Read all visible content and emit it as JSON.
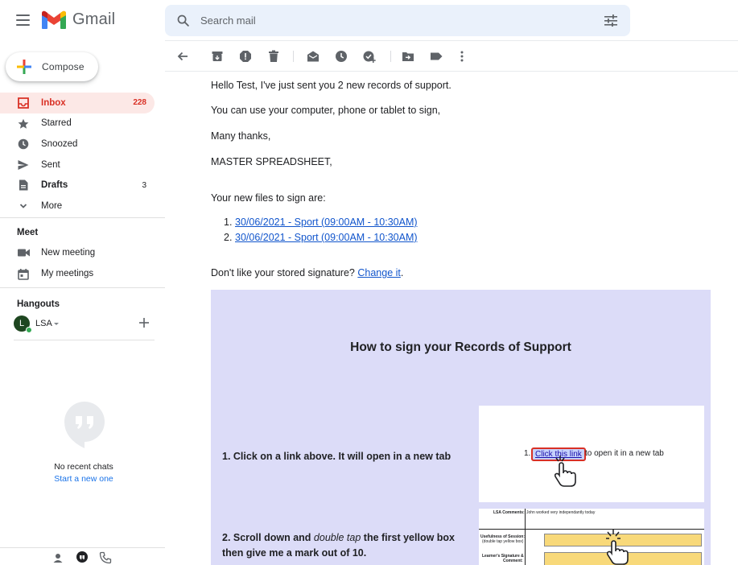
{
  "app": {
    "logo_text": "Gmail"
  },
  "search": {
    "placeholder": "Search mail"
  },
  "compose": {
    "label": "Compose"
  },
  "nav": [
    {
      "name": "inbox",
      "label": "Inbox",
      "count": "228",
      "icon": "inbox-icon",
      "active": true
    },
    {
      "name": "starred",
      "label": "Starred",
      "count": "",
      "icon": "star-icon"
    },
    {
      "name": "snoozed",
      "label": "Snoozed",
      "count": "",
      "icon": "clock-icon"
    },
    {
      "name": "sent",
      "label": "Sent",
      "count": "",
      "icon": "send-icon"
    },
    {
      "name": "drafts",
      "label": "Drafts",
      "count": "3",
      "icon": "draft-icon",
      "bold": true
    },
    {
      "name": "more",
      "label": "More",
      "count": "",
      "icon": "chevron-down-icon"
    }
  ],
  "meet": {
    "title": "Meet",
    "items": [
      {
        "label": "New meeting",
        "icon": "video-camera-icon"
      },
      {
        "label": "My meetings",
        "icon": "calendar-icon"
      }
    ]
  },
  "hangouts": {
    "title": "Hangouts",
    "user": {
      "initial": "L",
      "name": "LSA"
    },
    "empty_text": "No recent chats",
    "start_link": "Start a new one"
  },
  "toolbar": {
    "icons": [
      "back-arrow-icon",
      "archive-icon",
      "report-spam-icon",
      "delete-icon",
      "mark-unread-icon",
      "snooze-icon",
      "add-task-icon",
      "move-to-icon",
      "label-icon",
      "more-vert-icon"
    ]
  },
  "email": {
    "greeting": "Hello Test, I've just sent you 2 new records of support.",
    "line2": "You can use your computer, phone or tablet to sign,",
    "thanks": "Many thanks,",
    "sender": "MASTER SPREADSHEET,",
    "files_intro": "Your new files to sign are:",
    "files": [
      {
        "num": "1.",
        "label": "30/06/2021 - Sport (09:00AM - 10:30AM)"
      },
      {
        "num": "2.",
        "label": "30/06/2021 - Sport (09:00AM - 10:30AM)"
      }
    ],
    "signature_prefix": "Don't like your stored signature?",
    "signature_link": "Change it",
    "signature_suffix": "."
  },
  "guide": {
    "title": "How to sign your Records of Support",
    "step1": "1. Click on a link above. It will open in a new tab",
    "step2_prefix": "2. Scroll down and",
    "step2_em": "double tap",
    "step2_suffix": "the first yellow box",
    "step2_line2": "then give me a mark out of 10.",
    "shot1": {
      "num": "1.",
      "link": "Click this link",
      "rest": "to open it in a new tab"
    },
    "shot2": {
      "comments_label": "LSA Comments:",
      "comments_value": "John worked very independantly today",
      "usefulness_label": "Usefulness of Session:",
      "usefulness_hint": "(double tap yellow box)",
      "learner_label": "Learner's Signature &",
      "learner_label2": "Comment:"
    }
  },
  "colors": {
    "accent_red": "#d93025",
    "link_blue": "#1155cc",
    "guide_bg": "#dcdcf8",
    "inbox_bg": "#fce8e6"
  }
}
